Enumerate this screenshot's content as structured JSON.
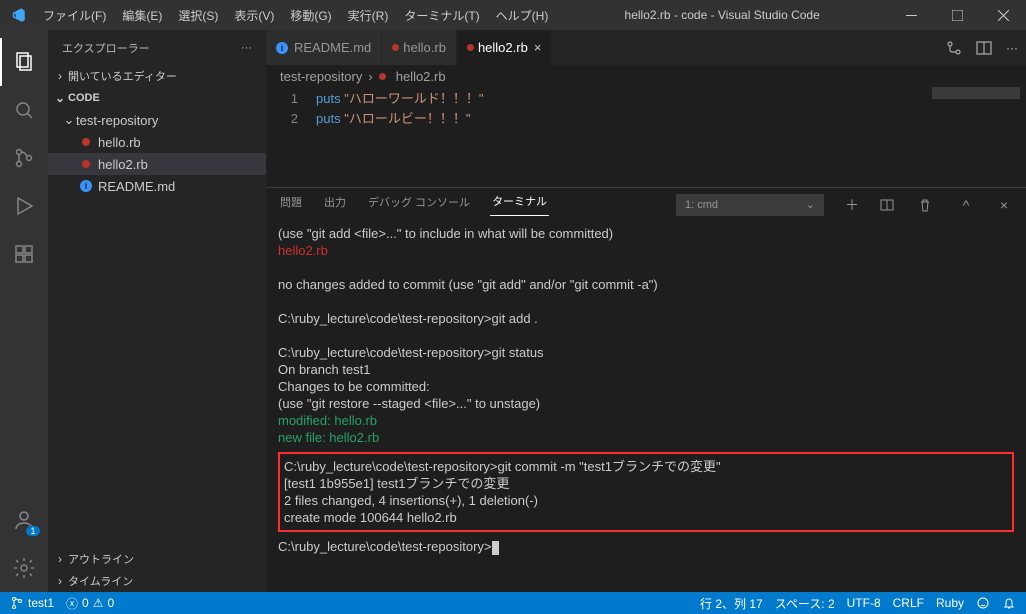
{
  "window": {
    "title": "hello2.rb - code - Visual Studio Code"
  },
  "menu": {
    "file": "ファイル(F)",
    "edit": "編集(E)",
    "select": "選択(S)",
    "view": "表示(V)",
    "go": "移動(G)",
    "run": "実行(R)",
    "terminal": "ターミナル(T)",
    "help": "ヘルプ(H)"
  },
  "explorer": {
    "title": "エクスプローラー",
    "open_editors": "開いているエディター",
    "root": "CODE",
    "folder": "test-repository",
    "files": {
      "hello": "hello.rb",
      "hello2": "hello2.rb",
      "readme": "README.md"
    },
    "outline": "アウトライン",
    "timeline": "タイムライン"
  },
  "tabs": {
    "readme": "README.md",
    "hello": "hello.rb",
    "hello2": "hello2.rb"
  },
  "breadcrumbs": {
    "root": "test-repository",
    "file": "hello2.rb",
    "sep": "›"
  },
  "code": {
    "line1_num": "1",
    "line2_num": "2",
    "kw": "puts",
    "str1": "\"ハローワールド！！！\"",
    "str2": "\"ハロールビー！！！\""
  },
  "panel": {
    "problems": "問題",
    "output": "出力",
    "debug": "デバッグ コンソール",
    "terminal": "ターミナル",
    "shell": "1: cmd"
  },
  "terminal": {
    "l1": "  (use \"git add <file>...\" to include in what will be committed)",
    "l2": "        hello2.rb",
    "l3": "no changes added to commit (use \"git add\" and/or \"git commit -a\")",
    "p1a": "C:\\ruby_lecture\\code\\test-repository>",
    "p1b": "git add .",
    "p2a": "C:\\ruby_lecture\\code\\test-repository>",
    "p2b": "git status",
    "l4": "On branch test1",
    "l5": "Changes to be committed:",
    "l6": "  (use \"git restore --staged <file>...\" to unstage)",
    "l7": "        modified:   hello.rb",
    "l8": "        new file:   hello2.rb",
    "p3a": "C:\\ruby_lecture\\code\\test-repository>",
    "p3b": "git commit -m \"test1ブランチでの変更\"",
    "l9": "[test1 1b955e1] test1ブランチでの変更",
    "l10": " 2 files changed, 4 insertions(+), 1 deletion(-)",
    "l11": " create mode 100644 hello2.rb",
    "p4": "C:\\ruby_lecture\\code\\test-repository>"
  },
  "status": {
    "branch": "test1",
    "errors": "0",
    "warnings": "0",
    "line_col": "行 2、列 17",
    "spaces": "スペース: 2",
    "encoding": "UTF-8",
    "eol": "CRLF",
    "lang": "Ruby"
  },
  "badges": {
    "accounts": "1"
  }
}
